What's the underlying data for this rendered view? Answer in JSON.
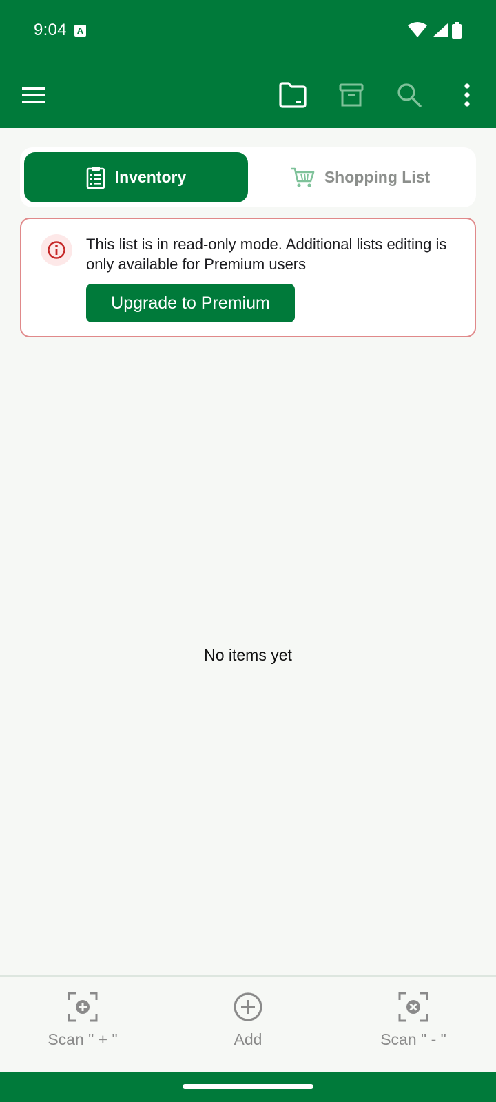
{
  "status_bar": {
    "time": "9:04",
    "notification_glyph": "A",
    "icons": [
      "wifi-icon",
      "signal-icon",
      "battery-icon"
    ]
  },
  "app_bar": {
    "icons": [
      "menu-icon",
      "folder-icon",
      "archive-icon",
      "search-icon",
      "more-vert-icon"
    ]
  },
  "tabs": [
    {
      "label": "Inventory",
      "icon": "clipboard-list-icon",
      "active": true
    },
    {
      "label": "Shopping List",
      "icon": "cart-icon",
      "active": false
    }
  ],
  "banner": {
    "message": "This list is in read-only mode. Additional lists editing is only available for Premium users",
    "button_label": "Upgrade to Premium",
    "icon": "info-icon"
  },
  "empty_state": {
    "text": "No items yet"
  },
  "bottom_actions": [
    {
      "label": "Scan \" + \"",
      "icon": "scan-plus-icon"
    },
    {
      "label": "Add",
      "icon": "add-circle-icon"
    },
    {
      "label": "Scan \" - \"",
      "icon": "scan-minus-icon"
    }
  ],
  "colors": {
    "primary": "#007a3a",
    "background": "#f6f8f5",
    "banner_border": "#e0898a",
    "error_icon": "#c62828"
  }
}
